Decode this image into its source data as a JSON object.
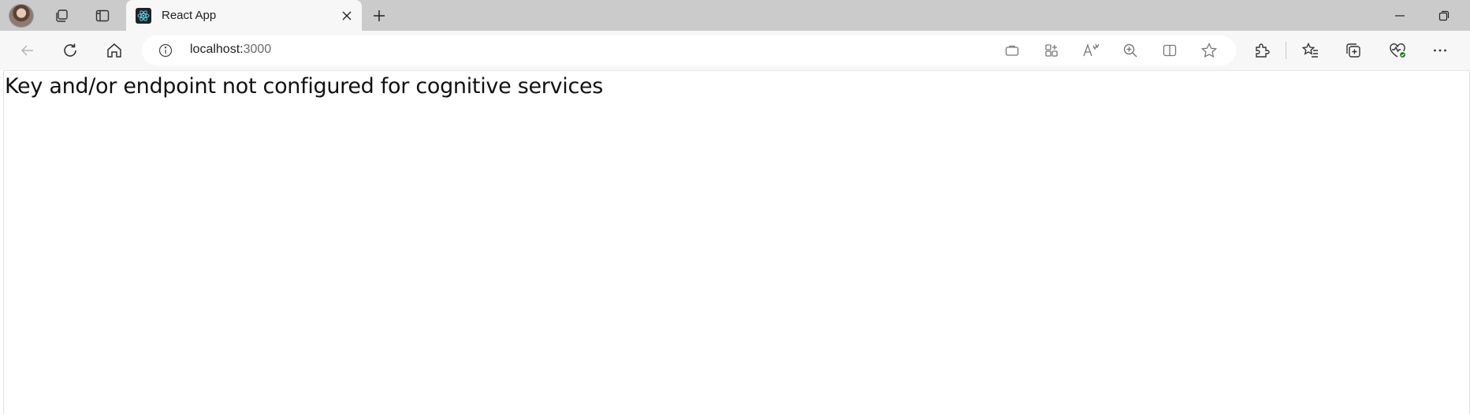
{
  "tab": {
    "title": "React App"
  },
  "address": {
    "host": "localhost:",
    "port": "3000"
  },
  "page": {
    "message": "Key and/or endpoint not configured for cognitive services"
  },
  "colors": {
    "tabstrip": "#cbcbcb",
    "toolbar": "#f7f7f7",
    "favicon_bg": "#222222",
    "react_blue": "#61dafb",
    "health_badge": "#107c10"
  },
  "icons": {
    "tabstrip": [
      "profile-avatar",
      "workspaces-icon",
      "vertical-tabs-icon",
      "react-favicon",
      "close-icon",
      "plus-icon",
      "minimize-icon",
      "restore-icon"
    ],
    "toolbar": [
      "back-arrow-icon",
      "refresh-icon",
      "home-icon",
      "info-icon",
      "briefcase-icon",
      "app-install-icon",
      "read-aloud-icon",
      "zoom-icon",
      "split-screen-icon",
      "star-icon",
      "extensions-icon",
      "favorites-icon",
      "collections-icon",
      "browser-essentials-icon",
      "more-icon"
    ]
  }
}
